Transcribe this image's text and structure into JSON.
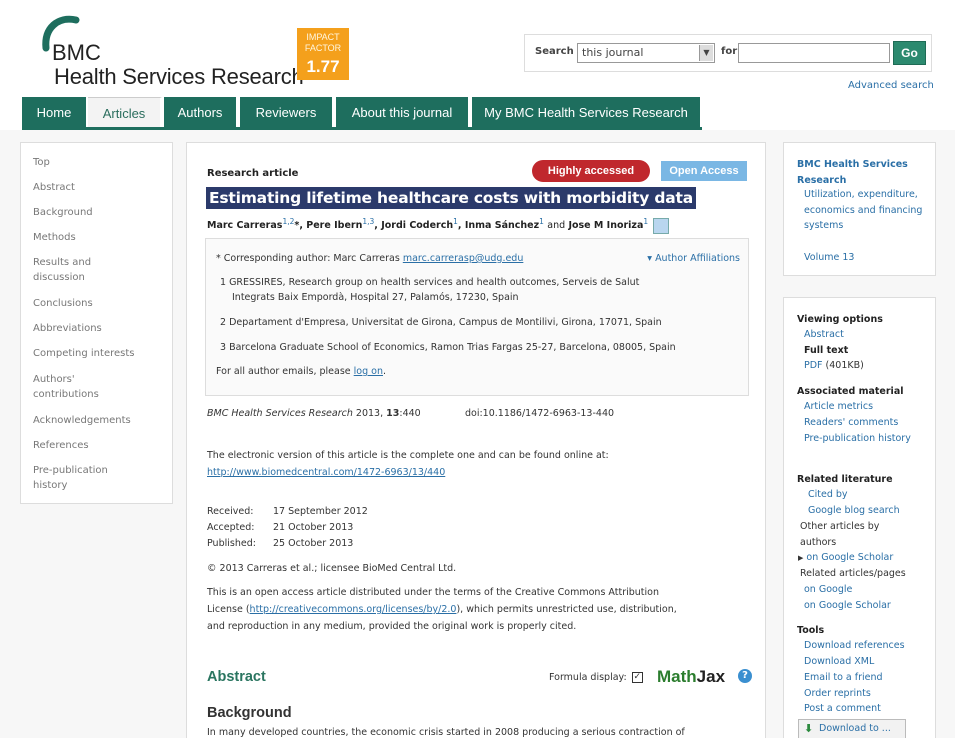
{
  "header": {
    "logo_bmc": "BMC",
    "logo_journal": "Health Services Research",
    "impact_label_1": "IMPACT",
    "impact_label_2": "FACTOR",
    "impact_value": "1.77",
    "search_label": "Search",
    "search_scope": "this journal",
    "for_label": "for",
    "search_value": "",
    "go_label": "Go",
    "advanced_search": "Advanced search"
  },
  "nav": {
    "tabs": [
      {
        "label": "Home"
      },
      {
        "label": "Articles"
      },
      {
        "label": "Authors"
      },
      {
        "label": "Reviewers"
      },
      {
        "label": "About this journal"
      },
      {
        "label": "My BMC Health Services Research"
      }
    ]
  },
  "sidebar_left": {
    "items": [
      "Top",
      "Abstract",
      "Background",
      "Methods",
      "Results and discussion",
      "Conclusions",
      "Abbreviations",
      "Competing interests",
      "Authors' contributions",
      "Acknowledgements",
      "References",
      "Pre-publication history"
    ]
  },
  "article": {
    "type": "Research article",
    "badge_highly": "Highly accessed",
    "badge_open": "Open Access",
    "title": "Estimating lifetime healthcare costs with morbidity data",
    "authors": [
      {
        "name": "Marc Carreras",
        "sup": "1,2",
        "mark": "*"
      },
      {
        "name": "Pere Ibern",
        "sup": "1,3"
      },
      {
        "name": "Jordi Coderch",
        "sup": "1"
      },
      {
        "name": "Inma Sánchez",
        "sup": "1"
      },
      {
        "name": "Jose M Inoriza",
        "sup": "1"
      }
    ],
    "and_word": "and",
    "corresponding_prefix": "* Corresponding author: Marc Carreras",
    "corresponding_email": "marc.carrerasp@udg.edu",
    "author_affiliations": "Author Affiliations",
    "affiliations": [
      "1 GRESSIRES, Research group on health services and health outcomes, Serveis de Salut",
      "Integrats Baix Empordà, Hospital 27, Palamós, 17230, Spain",
      "2 Departament d'Empresa, Universitat de Girona, Campus de Montilivi, Girona, 17071, Spain",
      "3 Barcelona Graduate School of Economics, Ramon Trias Fargas 25-27, Barcelona, 08005, Spain"
    ],
    "emails_text": "For all author emails, please",
    "emails_link": "log on",
    "cite_journal": "BMC Health Services Research",
    "cite_year": "2013,",
    "cite_volume": "13",
    "cite_page": ":440",
    "doi": "doi:10.1186/1472-6963-13-440",
    "online_text": "The electronic version of this article is the complete one and can be found online at:",
    "online_url": "http://www.biomedcentral.com/1472-6963/13/440",
    "dates": [
      {
        "label": "Received:",
        "value": "17 September 2012"
      },
      {
        "label": "Accepted:",
        "value": "21 October 2013"
      },
      {
        "label": "Published:",
        "value": "25 October 2013"
      }
    ],
    "copyright": "© 2013 Carreras et al.; licensee BioMed Central Ltd.",
    "license_1": "This is an open access article distributed under the terms of the Creative Commons Attribution",
    "license_2_pre": "License (",
    "license_url": "http://creativecommons.org/licenses/by/2.0",
    "license_2_post": "), which permits unrestricted use, distribution,",
    "license_3": "and reproduction in any medium, provided the original work is properly cited.",
    "abstract_heading": "Abstract",
    "formula_label": "Formula display:",
    "formula_check": "✓",
    "mathjax_math": "Math",
    "mathjax_jax": "Jax",
    "help": "?",
    "background_heading": "Background",
    "background_text": "In many developed countries, the economic crisis started in 2008 producing a serious contraction of"
  },
  "sidebar_right": {
    "box1": {
      "title": "BMC Health Services Research",
      "section": "Utilization, expenditure, economics and financing systems",
      "volume": "Volume 13"
    },
    "box2": {
      "viewing_head": "Viewing options",
      "abstract": "Abstract",
      "full_text": "Full text",
      "pdf": "PDF",
      "pdf_size": "(401KB)",
      "assoc_head": "Associated material",
      "metrics": "Article metrics",
      "comments": "Readers' comments",
      "prepub": "Pre-publication history",
      "related_head": "Related literature",
      "cited_by": "Cited by",
      "blog": "Google blog search",
      "other_articles": "Other articles by authors",
      "scholar1": "on Google Scholar",
      "related_articles": "Related articles/pages",
      "on_google": "on Google",
      "scholar2": "on Google Scholar",
      "tools_head": "Tools",
      "dl_refs": "Download references",
      "dl_xml": "Download XML",
      "email": "Email to a friend",
      "reprints": "Order reprints",
      "comment": "Post a comment",
      "dl_to": "Download to ..."
    }
  },
  "colors": {
    "nav_green": "#1e6e5e",
    "impact_orange": "#f4a01c",
    "link_blue": "#2a6fa6",
    "badge_red": "#c0282d",
    "badge_blue": "#7ab7e4"
  }
}
